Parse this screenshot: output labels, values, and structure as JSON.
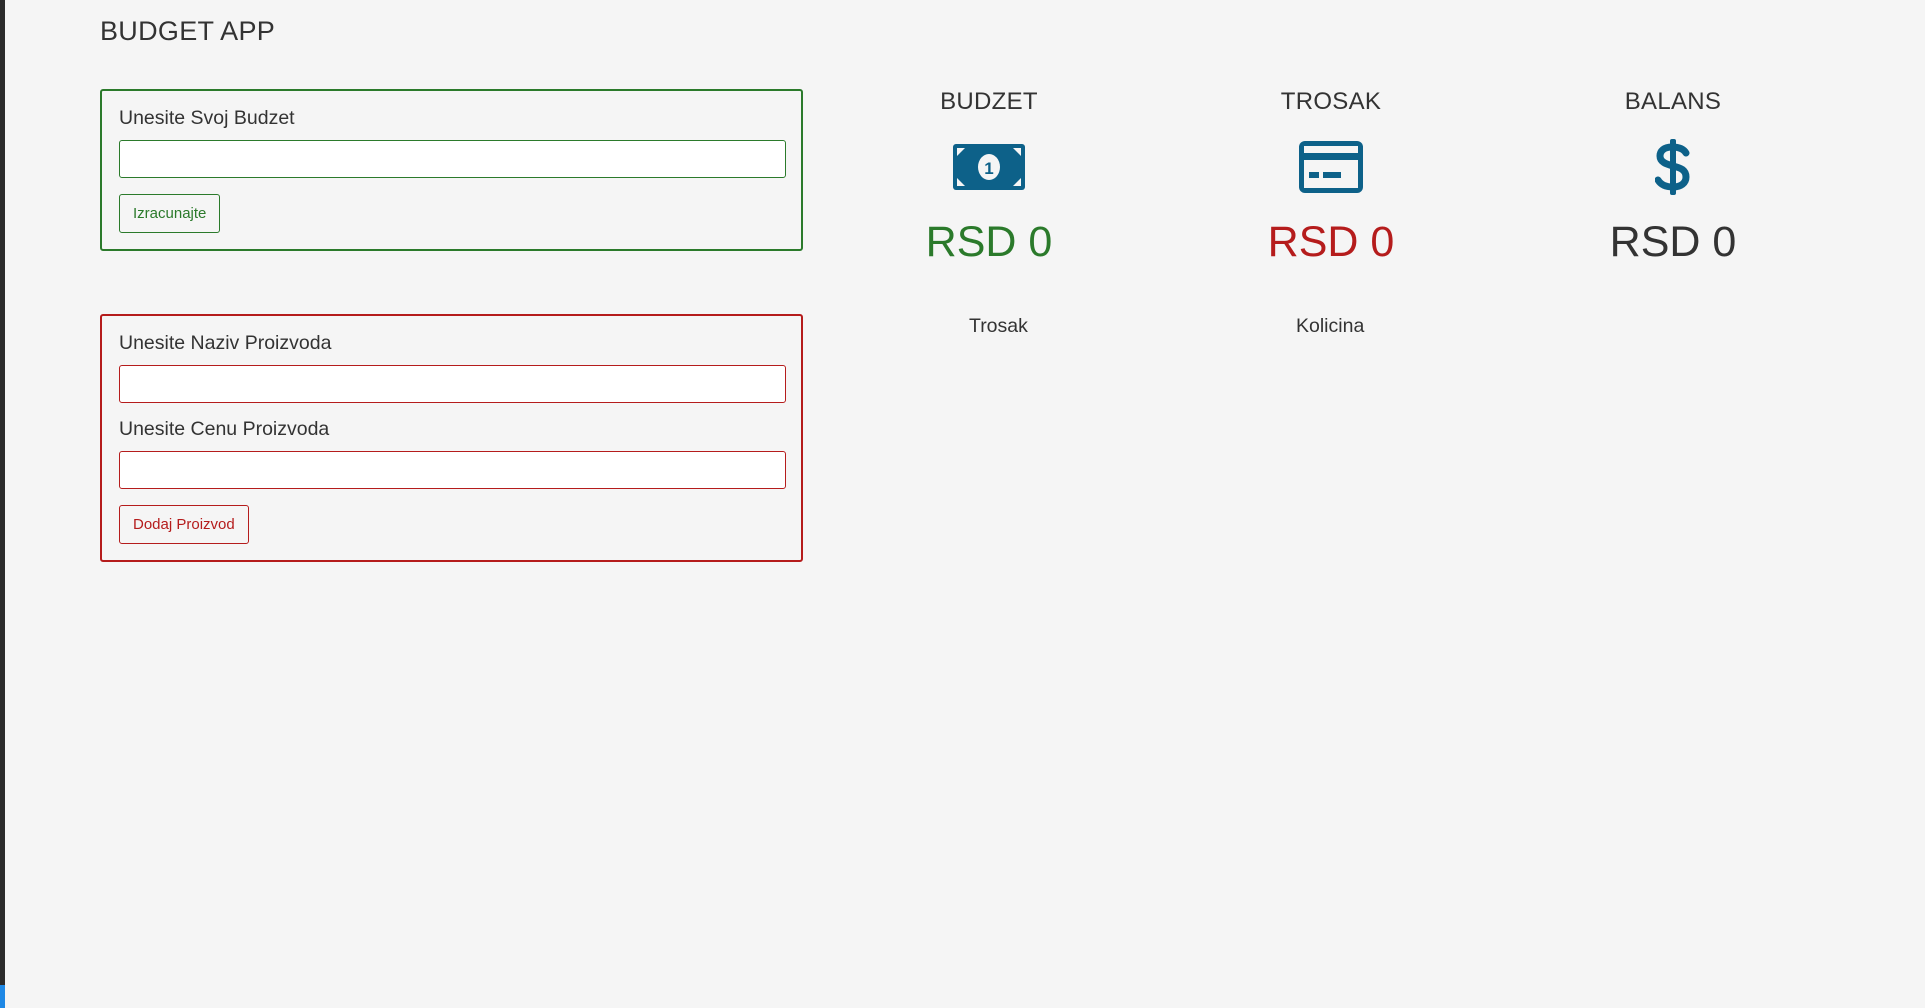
{
  "app": {
    "title": "BUDGET APP"
  },
  "budget_form": {
    "label": "Unesite Svoj Budzet",
    "value": "",
    "placeholder": "",
    "button_label": "Izracunajte"
  },
  "expense_form": {
    "name_label": "Unesite Naziv Proizvoda",
    "name_value": "",
    "name_placeholder": "",
    "price_label": "Unesite Cenu Proizvoda",
    "price_value": "",
    "price_placeholder": "",
    "button_label": "Dodaj Proizvod"
  },
  "stats": {
    "budget": {
      "title": "BUDZET",
      "value": "RSD 0",
      "icon": "money-bill-icon"
    },
    "expense": {
      "title": "TROSAK",
      "value": "RSD 0",
      "icon": "credit-card-icon"
    },
    "balance": {
      "title": "BALANS",
      "value": "RSD 0",
      "icon": "dollar-sign-icon"
    }
  },
  "expense_list": {
    "columns": [
      "Trosak",
      "Kolicina"
    ],
    "rows": []
  },
  "colors": {
    "green": "#2b7a2b",
    "red": "#b51c1c",
    "icon_blue": "#0d6189",
    "background": "#f5f5f5"
  }
}
